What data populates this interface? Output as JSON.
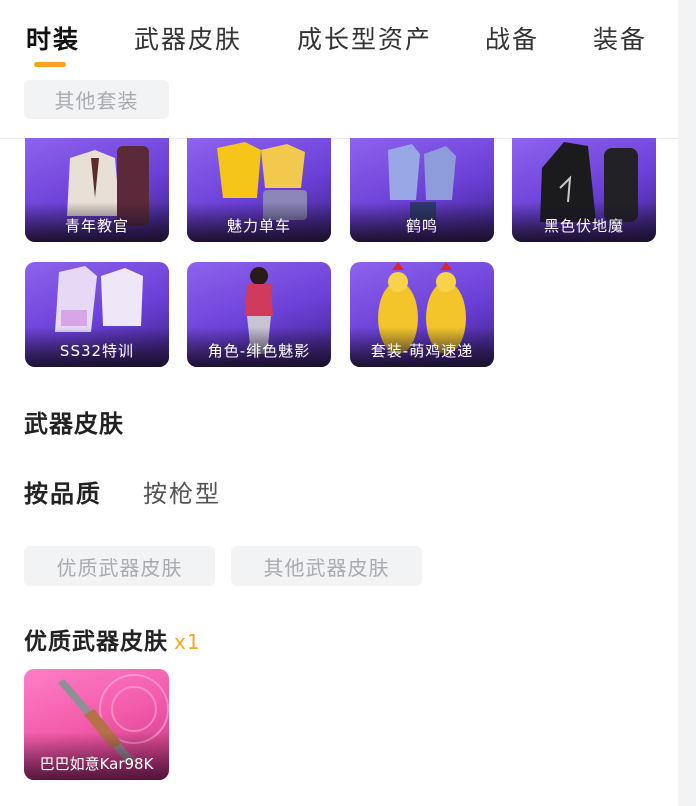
{
  "tabs": [
    {
      "label": "时装",
      "active": true
    },
    {
      "label": "武器皮肤",
      "active": false
    },
    {
      "label": "成长型资产",
      "active": false
    },
    {
      "label": "战备",
      "active": false
    },
    {
      "label": "装备",
      "active": false
    }
  ],
  "outfit_filter": {
    "label": "其他套装"
  },
  "outfits": [
    {
      "label": "青年教官"
    },
    {
      "label": "魅力单车"
    },
    {
      "label": "鹤鸣"
    },
    {
      "label": "黑色伏地魔"
    },
    {
      "label": "SS32特训"
    },
    {
      "label": "角色-绯色魅影"
    },
    {
      "label": "套装-萌鸡速递"
    }
  ],
  "weapon_section": {
    "title": "武器皮肤",
    "sort_tabs": [
      {
        "label": "按品质",
        "active": true
      },
      {
        "label": "按枪型",
        "active": false
      }
    ],
    "filters": [
      {
        "label": "优质武器皮肤"
      },
      {
        "label": "其他武器皮肤"
      }
    ],
    "group_title": "优质武器皮肤",
    "group_count": "x1",
    "items": [
      {
        "label": "巴巴如意Kar98K"
      }
    ]
  },
  "colors": {
    "accent": "#f7a51c",
    "card_purple": "#7b4fe0",
    "card_pink": "#f25aa9",
    "chip_bg": "#f2f3f5"
  }
}
